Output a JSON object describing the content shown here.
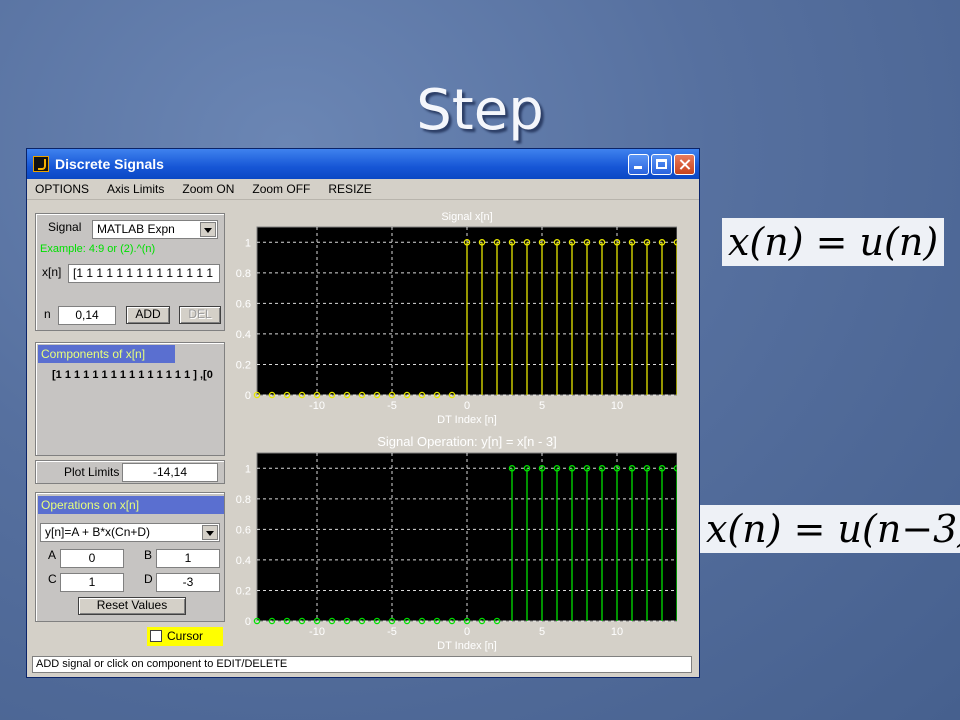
{
  "slide": {
    "title": "Step",
    "formula1": "x(n) = u(n)",
    "formula2": "x(n) = u(n−3)"
  },
  "window": {
    "title": "Discrete Signals",
    "icon": "matlab-icon",
    "menu": [
      "OPTIONS",
      "Axis Limits",
      "Zoom ON",
      "Zoom OFF",
      "RESIZE"
    ]
  },
  "signal_panel": {
    "signal_label": "Signal",
    "signal_select": "MATLAB Expn",
    "example_text": "Example: 4:9 or (2).^(n)",
    "xn_label": "x[n]",
    "xn_value": "[1 1 1 1 1 1 1 1 1 1 1 1 1 1",
    "n_label": "n",
    "n_value": "0,14",
    "add_label": "ADD",
    "del_label": "DEL"
  },
  "components_panel": {
    "header": "Components of x[n]",
    "content": "[1 1 1 1 1 1 1 1 1 1 1 1 1 1 1 ] ,[0"
  },
  "plot_limits": {
    "label": "Plot Limits",
    "value": "-14,14"
  },
  "operations": {
    "header": "Operations on x[n]",
    "select": "y[n]=A + B*x(Cn+D)",
    "a_label": "A",
    "a_value": "0",
    "b_label": "B",
    "b_value": "1",
    "c_label": "C",
    "c_value": "1",
    "d_label": "D",
    "d_value": "-3",
    "reset_label": "Reset Values"
  },
  "cursor_label": "Cursor",
  "status_text": "ADD signal or click on component to EDIT/DELETE",
  "colors": {
    "plot_bg": "#000000",
    "signal_color": "#e8e800",
    "operation_color": "#00e000"
  },
  "chart_data": [
    {
      "type": "scatter",
      "title": "Signal  x[n]",
      "xlabel": "DT  Index  [n]",
      "ylabel": "",
      "xlim": [
        -14,
        14
      ],
      "ylim": [
        0,
        1.1
      ],
      "xticks": [
        -10,
        -5,
        0,
        5,
        10
      ],
      "yticks": [
        0,
        0.2,
        0.4,
        0.6,
        0.8,
        1
      ],
      "grid": true,
      "series": [
        {
          "x": [
            -14,
            -13,
            -12,
            -11,
            -10,
            -9,
            -8,
            -7,
            -6,
            -5,
            -4,
            -3,
            -2,
            -1,
            0,
            1,
            2,
            3,
            4,
            5,
            6,
            7,
            8,
            9,
            10,
            11,
            12,
            13,
            14
          ],
          "values": [
            0,
            0,
            0,
            0,
            0,
            0,
            0,
            0,
            0,
            0,
            0,
            0,
            0,
            0,
            1,
            1,
            1,
            1,
            1,
            1,
            1,
            1,
            1,
            1,
            1,
            1,
            1,
            1,
            1
          ]
        }
      ]
    },
    {
      "type": "scatter",
      "title": "Signal Operation: y[n] = x[n - 3]",
      "xlabel": "DT  Index  [n]",
      "ylabel": "",
      "xlim": [
        -14,
        14
      ],
      "ylim": [
        0,
        1.1
      ],
      "xticks": [
        -10,
        -5,
        0,
        5,
        10
      ],
      "yticks": [
        0,
        0.2,
        0.4,
        0.6,
        0.8,
        1
      ],
      "grid": true,
      "series": [
        {
          "x": [
            -14,
            -13,
            -12,
            -11,
            -10,
            -9,
            -8,
            -7,
            -6,
            -5,
            -4,
            -3,
            -2,
            -1,
            0,
            1,
            2,
            3,
            4,
            5,
            6,
            7,
            8,
            9,
            10,
            11,
            12,
            13,
            14
          ],
          "values": [
            0,
            0,
            0,
            0,
            0,
            0,
            0,
            0,
            0,
            0,
            0,
            0,
            0,
            0,
            0,
            0,
            0,
            1,
            1,
            1,
            1,
            1,
            1,
            1,
            1,
            1,
            1,
            1,
            1
          ]
        }
      ]
    }
  ]
}
